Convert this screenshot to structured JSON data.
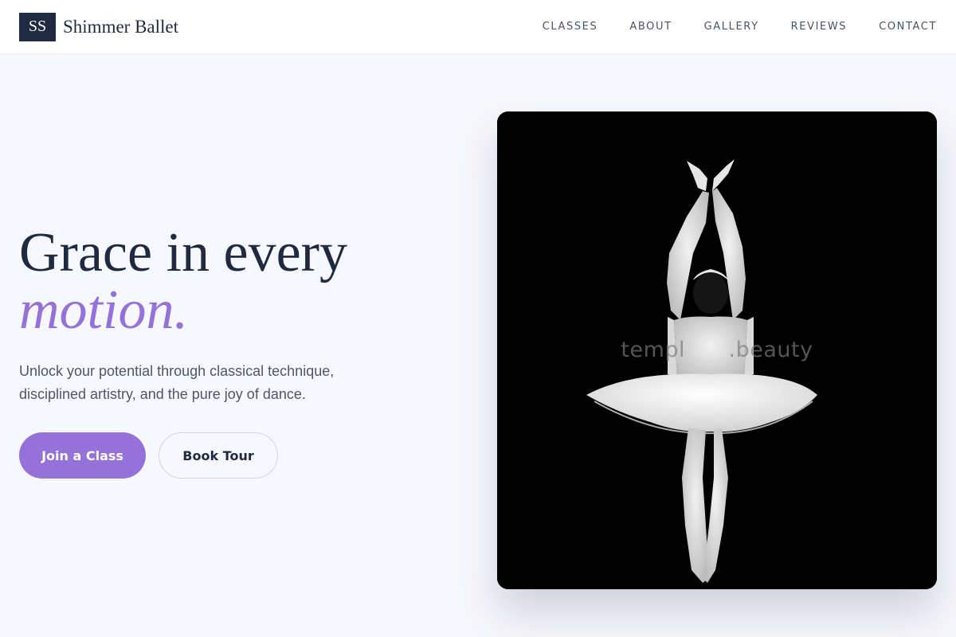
{
  "header": {
    "logo_initials": "SS",
    "brand_name": "Shimmer Ballet",
    "nav": [
      {
        "label": "CLASSES"
      },
      {
        "label": "ABOUT"
      },
      {
        "label": "GALLERY"
      },
      {
        "label": "REVIEWS"
      },
      {
        "label": "CONTACT"
      }
    ]
  },
  "hero": {
    "headline_line1": "Grace in every",
    "headline_accent": "motion.",
    "subtitle": "Unlock your potential through classical technique, disciplined artistry, and the pure joy of dance.",
    "primary_cta": "Join a Class",
    "secondary_cta": "Book Tour",
    "image": {
      "subject": "ballerina-photo",
      "watermark": "templ      .beauty"
    }
  },
  "colors": {
    "navy": "#1f2a40",
    "accent_purple": "#9472d9",
    "background": "#f7f8fd",
    "muted_text": "#4d566a"
  }
}
